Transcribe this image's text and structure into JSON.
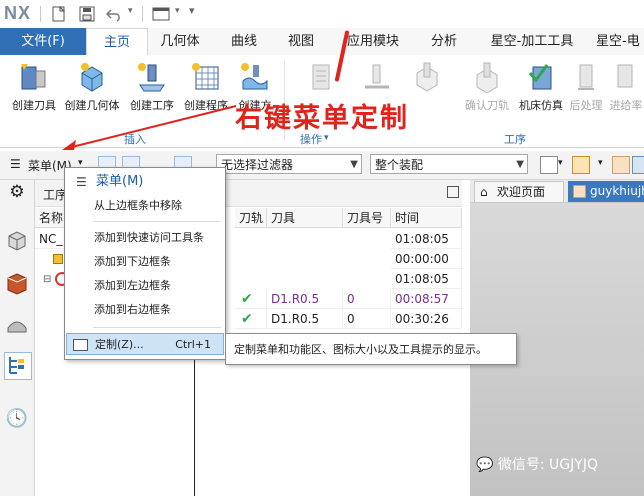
{
  "app": {
    "logo": "NX"
  },
  "ribbon_tabs": [
    "文件(F)",
    "主页",
    "几何体",
    "曲线",
    "视图",
    "应用模块",
    "分析",
    "星空-加工工具",
    "星空-电"
  ],
  "ribbon": {
    "insert_buttons": [
      "创建刀具",
      "创建几何体",
      "创建工序",
      "创建程序",
      "创建方"
    ],
    "op_buttons": [
      "",
      "",
      "",
      "确认刀轨",
      "机床仿真",
      "后处理",
      "进给率"
    ],
    "groups": {
      "insert": "插入",
      "operate": "操作",
      "process": "工序"
    }
  },
  "annotation": {
    "text": "右键菜单定制"
  },
  "toolbar": {
    "menu_label": "菜单(M)",
    "filter_placeholder": "无选择过滤器",
    "assembly_value": "整个装配"
  },
  "navigator": {
    "header_label": "工序",
    "columns": [
      "名称",
      "刀轨",
      "刀具",
      "刀具号",
      "时间"
    ],
    "rows": [
      {
        "name": "NC_",
        "path": "",
        "tool": "",
        "tool_no": "",
        "time": "01:08:05"
      },
      {
        "name": "",
        "path": "",
        "tool": "",
        "tool_no": "",
        "time": "00:00:00"
      },
      {
        "name": "",
        "path": "",
        "tool": "",
        "tool_no": "",
        "time": "01:08:05"
      },
      {
        "name": "",
        "path": "✔",
        "tool": "D1.R0.5",
        "tool_no": "0",
        "time": "00:08:57"
      },
      {
        "name": "",
        "path": "✔",
        "tool": "D1.R0.5",
        "tool_no": "0",
        "time": "00:30:26"
      }
    ]
  },
  "context_menu": {
    "title": "菜单(M)",
    "items": [
      "从上边框条中移除",
      "添加到快速访问工具条",
      "添加到下边框条",
      "添加到左边框条",
      "添加到右边框条"
    ],
    "customize_label": "定制(Z)...",
    "customize_shortcut": "Ctrl+1"
  },
  "tooltip": {
    "text": "定制菜单和功能区、图标大小以及工具提示的显示。"
  },
  "graphics_tabs": {
    "welcome": "欢迎页面",
    "part": "guykhiujh"
  },
  "watermark": {
    "text": "微信号: UGJYJQ"
  },
  "colors": {
    "accent": "#2f6fb6",
    "annotation": "#e0231b",
    "menu_highlight": "#cfe3f7",
    "check": "#2ba84a"
  }
}
